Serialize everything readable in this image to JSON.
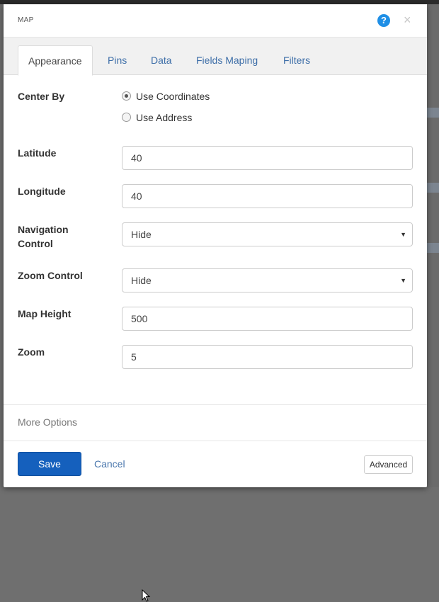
{
  "dialog": {
    "title": "MAP",
    "help_icon": "?",
    "close_icon": "×"
  },
  "tabs": [
    {
      "label": "Appearance",
      "active": true
    },
    {
      "label": "Pins",
      "active": false
    },
    {
      "label": "Data",
      "active": false
    },
    {
      "label": "Fields Maping",
      "active": false
    },
    {
      "label": "Filters",
      "active": false
    }
  ],
  "form": {
    "center_by": {
      "label": "Center By",
      "options": [
        {
          "label": "Use Coordinates",
          "checked": true
        },
        {
          "label": "Use Address",
          "checked": false
        }
      ]
    },
    "latitude": {
      "label": "Latitude",
      "value": "40"
    },
    "longitude": {
      "label": "Longitude",
      "value": "40"
    },
    "navigation_control": {
      "label_line1": "Navigation",
      "label_line2": "Control",
      "value": "Hide"
    },
    "zoom_control": {
      "label": "Zoom Control",
      "value": "Hide"
    },
    "map_height": {
      "label": "Map Height",
      "value": "500"
    },
    "zoom": {
      "label": "Zoom",
      "value": "5"
    }
  },
  "more_options": "More Options",
  "footer": {
    "save_label": "Save",
    "cancel_label": "Cancel",
    "advanced_label": "Advanced"
  },
  "colors": {
    "primary": "#1560bd",
    "link": "#3d6ea8",
    "help": "#1f8fe6"
  }
}
